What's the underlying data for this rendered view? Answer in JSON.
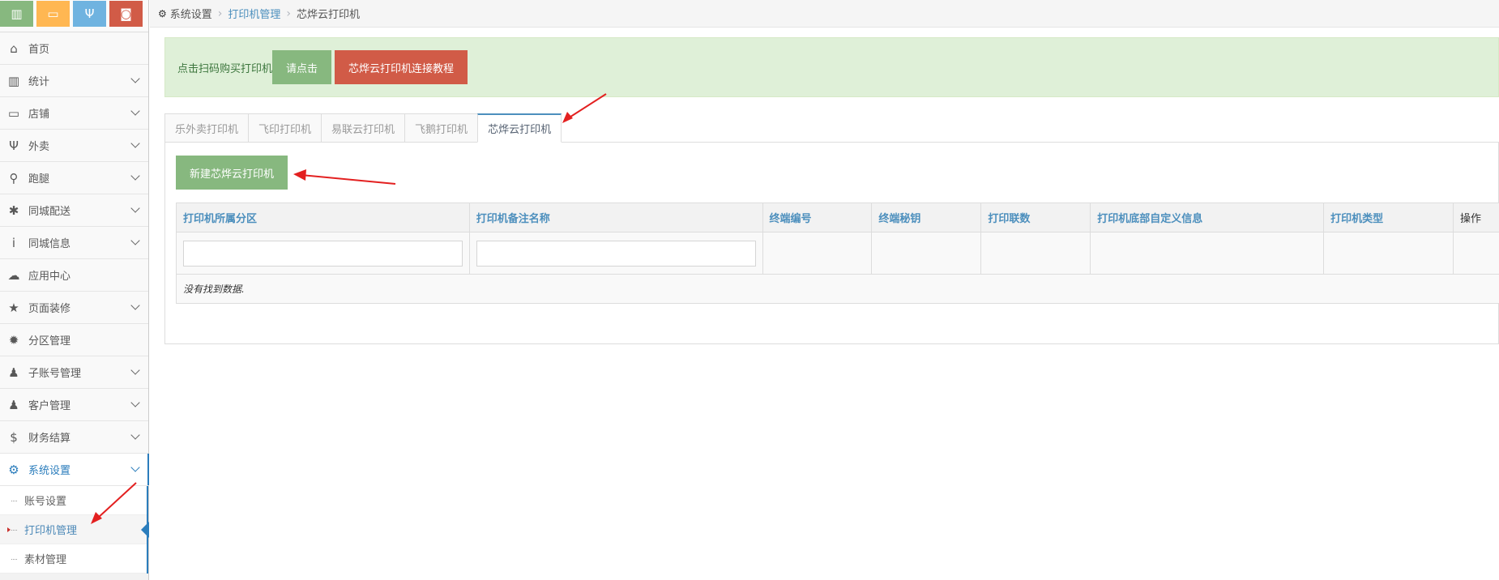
{
  "shortcuts": [
    {
      "name": "chart-icon",
      "glyph": "▥",
      "color": "#87b87f"
    },
    {
      "name": "desktop-icon",
      "glyph": "▭",
      "color": "#ffb752"
    },
    {
      "name": "restaurant-icon",
      "glyph": "Ψ",
      "color": "#6fb3e0"
    },
    {
      "name": "shopping-bag-icon",
      "glyph": "◙",
      "color": "#d15b47"
    }
  ],
  "sidebar": {
    "items": [
      {
        "label": "首页",
        "icon": "home-icon",
        "glyph": "⌂"
      },
      {
        "label": "统计",
        "icon": "bar-chart-icon",
        "glyph": "▥"
      },
      {
        "label": "店铺",
        "icon": "desktop-icon",
        "glyph": "▭"
      },
      {
        "label": "外卖",
        "icon": "cutlery-icon",
        "glyph": "Ψ"
      },
      {
        "label": "跑腿",
        "icon": "bicycle-icon",
        "glyph": "⚲"
      },
      {
        "label": "同城配送",
        "icon": "asterisk-icon",
        "glyph": "✱"
      },
      {
        "label": "同城信息",
        "icon": "info-icon",
        "glyph": "i"
      },
      {
        "label": "应用中心",
        "icon": "cloud-icon",
        "glyph": "☁"
      },
      {
        "label": "页面装修",
        "icon": "star-icon",
        "glyph": "★"
      },
      {
        "label": "分区管理",
        "icon": "certificate-icon",
        "glyph": "✹"
      },
      {
        "label": "子账号管理",
        "icon": "user-icon",
        "glyph": "♟"
      },
      {
        "label": "客户管理",
        "icon": "users-icon",
        "glyph": "♟"
      },
      {
        "label": "财务结算",
        "icon": "dollar-icon",
        "glyph": "$"
      },
      {
        "label": "系统设置",
        "icon": "cog-icon",
        "glyph": "⚙"
      }
    ],
    "sub_items": [
      {
        "label": "账号设置"
      },
      {
        "label": "打印机管理"
      },
      {
        "label": "素材管理"
      }
    ]
  },
  "breadcrumb": {
    "root": "系统设置",
    "middle": "打印机管理",
    "current": "芯烨云打印机"
  },
  "notice": {
    "text": "点击扫码购买打印机",
    "button_1": "请点击",
    "button_2": "芯烨云打印机连接教程"
  },
  "tabs": [
    "乐外卖打印机",
    "飞印打印机",
    "易联云打印机",
    "飞鹅打印机",
    "芯烨云打印机"
  ],
  "panel": {
    "new_button": "新建芯烨云打印机",
    "columns": [
      "打印机所属分区",
      "打印机备注名称",
      "终端编号",
      "终端秘钥",
      "打印联数",
      "打印机底部自定义信息",
      "打印机类型",
      "操作"
    ],
    "empty_text": "没有找到数据."
  },
  "colors": {
    "accent": "#4c8fbd",
    "success": "#87b87f",
    "danger": "#d15b47",
    "arrow": "#e32020"
  }
}
